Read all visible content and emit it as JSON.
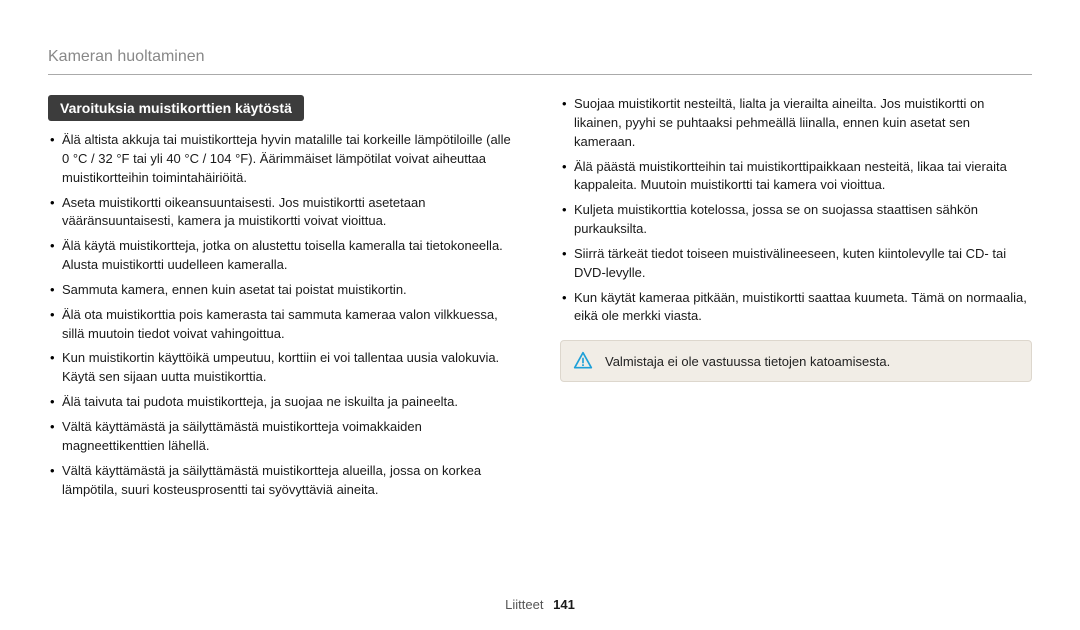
{
  "header": "Kameran huoltaminen",
  "section_title": "Varoituksia muistikorttien käytöstä",
  "left_items": [
    "Älä altista akkuja tai muistikortteja hyvin matalille tai korkeille lämpötiloille (alle 0 °C / 32 °F tai yli 40 °C / 104 °F). Äärimmäiset lämpötilat voivat aiheuttaa muistikortteihin toimintahäiriöitä.",
    "Aseta muistikortti oikeansuuntaisesti. Jos muistikortti asetetaan vääränsuuntaisesti, kamera ja muistikortti voivat vioittua.",
    "Älä käytä muistikortteja, jotka on alustettu toisella kameralla tai tietokoneella. Alusta muistikortti uudelleen kameralla.",
    "Sammuta kamera, ennen kuin asetat tai poistat muistikortin.",
    "Älä ota muistikorttia pois kamerasta tai sammuta kameraa valon vilkkuessa, sillä muutoin tiedot voivat vahingoittua.",
    "Kun muistikortin käyttöikä umpeutuu, korttiin ei voi tallentaa uusia valokuvia. Käytä sen sijaan uutta muistikorttia.",
    "Älä taivuta tai pudota muistikortteja, ja suojaa ne iskuilta ja paineelta.",
    "Vältä käyttämästä ja säilyttämästä muistikortteja voimakkaiden magneettikenttien lähellä.",
    "Vältä käyttämästä ja säilyttämästä muistikortteja alueilla, jossa on korkea lämpötila, suuri kosteusprosentti tai syövyttäviä aineita."
  ],
  "right_items": [
    "Suojaa muistikortit nesteiltä, lialta ja vierailta aineilta. Jos muistikortti on likainen, pyyhi se puhtaaksi pehmeällä liinalla, ennen kuin asetat sen kameraan.",
    "Älä päästä muistikortteihin tai muistikorttipaikkaan nesteitä, likaa tai vieraita kappaleita. Muutoin muistikortti tai kamera voi vioittua.",
    "Kuljeta muistikorttia kotelossa, jossa se on suojassa staattisen sähkön purkauksilta.",
    "Siirrä tärkeät tiedot toiseen muistivälineeseen, kuten kiintolevylle tai CD- tai DVD-levylle.",
    "Kun käytät kameraa pitkään, muistikortti saattaa kuumeta. Tämä on normaalia, eikä ole merkki viasta."
  ],
  "note": "Valmistaja ei ole vastuussa tietojen katoamisesta.",
  "footer_label": "Liitteet",
  "footer_page": "141"
}
